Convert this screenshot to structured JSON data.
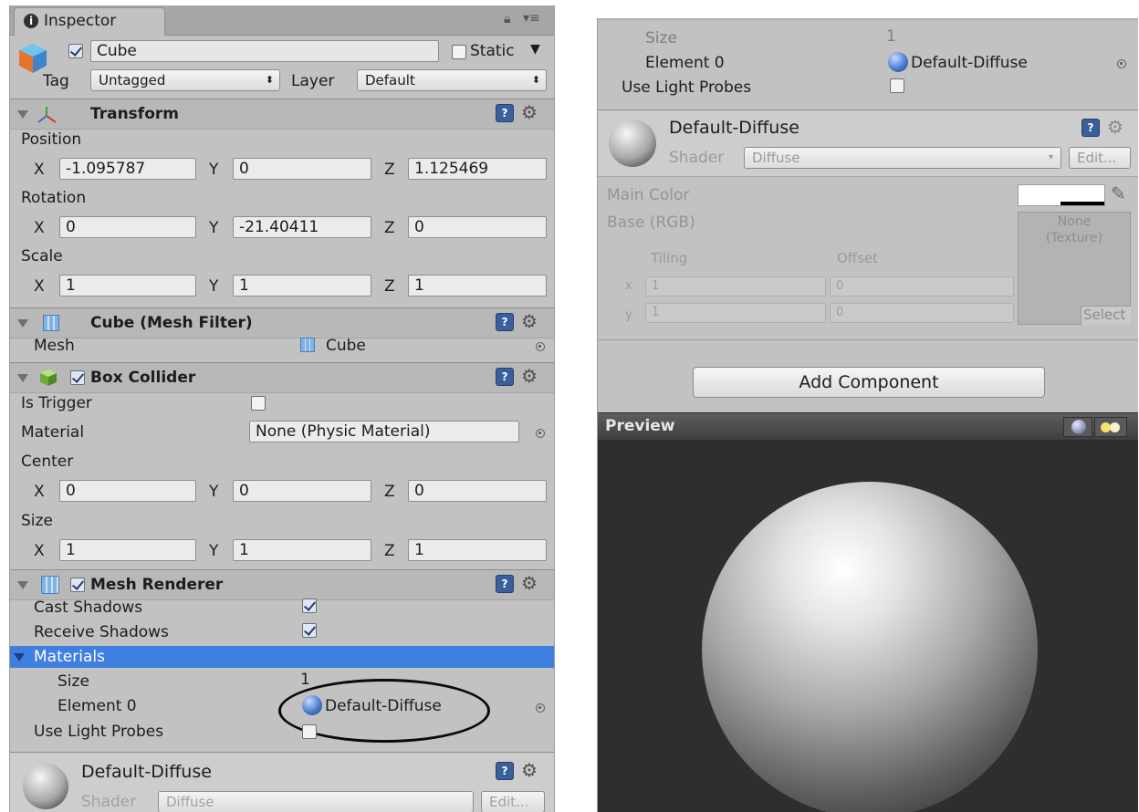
{
  "left": {
    "tab": {
      "label": "Inspector",
      "icon": "info-icon"
    },
    "object": {
      "name": "Cube",
      "static_label": "Static",
      "tag_label": "Tag",
      "tag_value": "Untagged",
      "layer_label": "Layer",
      "layer_value": "Default"
    },
    "transform": {
      "title": "Transform",
      "position_label": "Position",
      "position": {
        "x": "-1.095787",
        "y": "0",
        "z": "1.125469"
      },
      "rotation_label": "Rotation",
      "rotation": {
        "x": "0",
        "y": "-21.40411",
        "z": "0"
      },
      "scale_label": "Scale",
      "scale": {
        "x": "1",
        "y": "1",
        "z": "1"
      }
    },
    "axis": {
      "x": "X",
      "y": "Y",
      "z": "Z"
    },
    "mesh_filter": {
      "title": "Cube (Mesh Filter)",
      "mesh_label": "Mesh",
      "mesh_value": "Cube"
    },
    "box_collider": {
      "title": "Box Collider",
      "is_trigger_label": "Is Trigger",
      "material_label": "Material",
      "material_value": "None (Physic Material)",
      "center_label": "Center",
      "center": {
        "x": "0",
        "y": "0",
        "z": "0"
      },
      "size_label": "Size",
      "size": {
        "x": "1",
        "y": "1",
        "z": "1"
      }
    },
    "mesh_renderer": {
      "title": "Mesh Renderer",
      "cast_shadows_label": "Cast Shadows",
      "receive_shadows_label": "Receive Shadows",
      "materials_label": "Materials",
      "size_label": "Size",
      "size_value": "1",
      "element0_label": "Element 0",
      "element0_value": "Default-Diffuse",
      "light_probes_label": "Use Light Probes"
    },
    "material": {
      "name": "Default-Diffuse",
      "shader_label": "Shader",
      "shader_value": "Diffuse",
      "edit_label": "Edit..."
    }
  },
  "right": {
    "size_label": "Size",
    "size_value": "1",
    "element0_label": "Element 0",
    "element0_value": "Default-Diffuse",
    "light_probes_label": "Use Light Probes",
    "material": {
      "name": "Default-Diffuse",
      "shader_label": "Shader",
      "shader_value": "Diffuse",
      "edit_label": "Edit..."
    },
    "main_color_label": "Main Color",
    "base_label": "Base (RGB)",
    "texture_label_1": "None",
    "texture_label_2": "(Texture)",
    "select_label": "Select",
    "tiling_label": "Tiling",
    "offset_label": "Offset",
    "x_label": "x",
    "y_label": "y",
    "tiling": {
      "x": "1",
      "y": "1"
    },
    "offset": {
      "x": "0",
      "y": "0"
    },
    "add_component_label": "Add Component",
    "preview_label": "Preview"
  },
  "colors": {
    "selection": "#3f7fe0",
    "panel": "#c2c2c2",
    "preview_bg": "#2e2e2e"
  }
}
